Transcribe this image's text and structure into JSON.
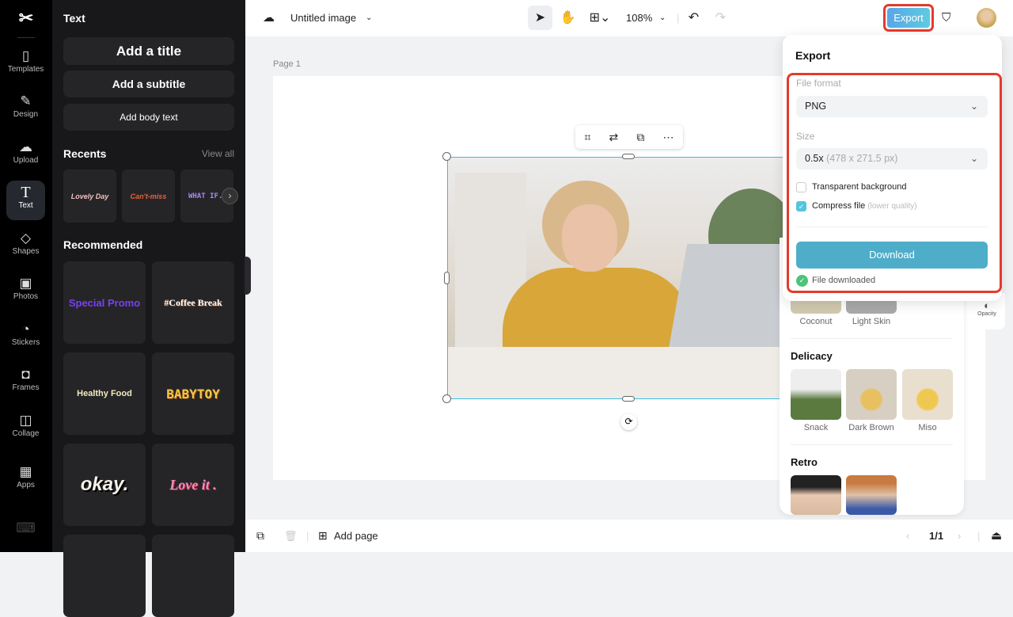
{
  "rail": {
    "items": [
      {
        "label": "Templates",
        "icon": "templates-icon"
      },
      {
        "label": "Design",
        "icon": "design-icon"
      },
      {
        "label": "Upload",
        "icon": "upload-icon"
      },
      {
        "label": "Text",
        "icon": "text-icon"
      },
      {
        "label": "Shapes",
        "icon": "shapes-icon"
      },
      {
        "label": "Photos",
        "icon": "photos-icon"
      },
      {
        "label": "Stickers",
        "icon": "stickers-icon"
      },
      {
        "label": "Frames",
        "icon": "frames-icon"
      },
      {
        "label": "Collage",
        "icon": "collage-icon"
      },
      {
        "label": "Apps",
        "icon": "apps-icon"
      }
    ]
  },
  "panel": {
    "title": "Text",
    "add_title": "Add a title",
    "add_subtitle": "Add a subtitle",
    "add_body": "Add body text",
    "recents": "Recents",
    "view_all": "View all",
    "recent_items": [
      "Lovely Day",
      "Can't-miss",
      "WHAT IF..."
    ],
    "recommended": "Recommended",
    "recommended_items": [
      "Special Promo",
      "#Coffee Break",
      "Healthy Food",
      "BABYTOY",
      "okay.",
      "Love it ."
    ]
  },
  "topbar": {
    "doc_title": "Untitled image",
    "zoom": "108%",
    "export": "Export"
  },
  "canvas": {
    "page_label": "Page 1"
  },
  "export": {
    "title": "Export",
    "file_format_label": "File format",
    "file_format": "PNG",
    "size_label": "Size",
    "size": "0.5x",
    "size_detail": "(478 x 271.5 px)",
    "transparent": "Transparent background",
    "transparent_checked": false,
    "compress": "Compress file",
    "compress_note": "(lower quality)",
    "compress_checked": true,
    "download": "Download",
    "status": "File downloaded"
  },
  "filters": {
    "row1": [
      "Coconut",
      "Light Skin"
    ],
    "delicacy": "Delicacy",
    "delicacy_items": [
      "Snack",
      "Dark Brown",
      "Miso"
    ],
    "retro": "Retro"
  },
  "side": {
    "opacity": "Opacity"
  },
  "bottombar": {
    "add_page": "Add page",
    "pages": "1/1"
  }
}
